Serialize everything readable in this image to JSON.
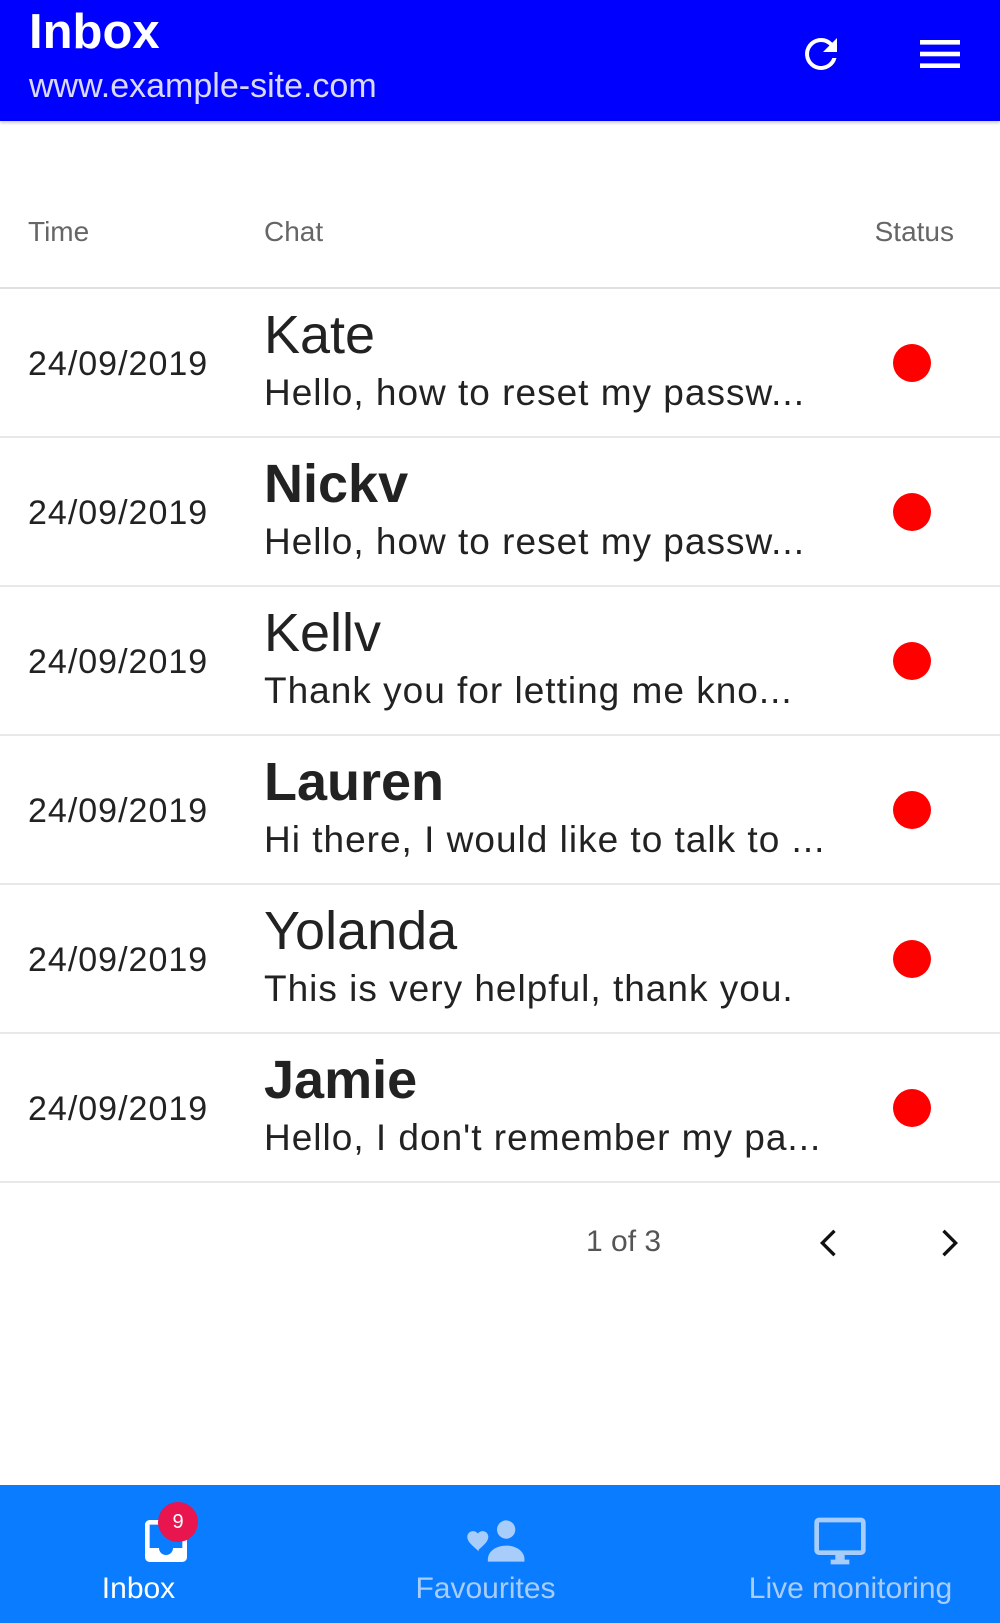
{
  "header": {
    "title": "Inbox",
    "subtitle": "www.example-site.com",
    "refresh_icon": "refresh-icon",
    "menu_icon": "menu-icon"
  },
  "table": {
    "columns": [
      "Time",
      "Chat",
      "Status"
    ],
    "rows": [
      {
        "date": "24/09/2019",
        "name": "Kate",
        "preview": "Hello, how to reset my passw...",
        "bold": false,
        "status_color": "#ff0000"
      },
      {
        "date": "24/09/2019",
        "name": "Nickv",
        "preview": "Hello, how to reset my passw...",
        "bold": true,
        "status_color": "#ff0000"
      },
      {
        "date": "24/09/2019",
        "name": "Kellv",
        "preview": "Thank you for letting me kno...",
        "bold": false,
        "status_color": "#ff0000"
      },
      {
        "date": "24/09/2019",
        "name": "Lauren",
        "preview": "Hi there, I would like to talk to ...",
        "bold": true,
        "status_color": "#ff0000"
      },
      {
        "date": "24/09/2019",
        "name": "Yolanda",
        "preview": "This is very helpful, thank you.",
        "bold": false,
        "status_color": "#ff0000"
      },
      {
        "date": "24/09/2019",
        "name": "Jamie",
        "preview": "Hello, I don't remember my pa...",
        "bold": true,
        "status_color": "#ff0000"
      }
    ]
  },
  "pagination": {
    "label": "1 of 3",
    "prev_icon": "chevron-left-icon",
    "next_icon": "chevron-right-icon"
  },
  "bottom_nav": {
    "items": [
      {
        "label": "Inbox",
        "icon": "inbox-icon",
        "active": true,
        "badge": "9"
      },
      {
        "label": "Favourites",
        "icon": "people-heart-icon",
        "active": false
      },
      {
        "label": "Live monitoring",
        "icon": "monitor-icon",
        "active": false
      }
    ]
  },
  "colors": {
    "header_bg": "#0000ff",
    "bottom_nav_bg": "#0a7cff",
    "status_unread": "#ff0000",
    "badge": "#e8154f",
    "nav_inactive": "#a8cdfb"
  }
}
